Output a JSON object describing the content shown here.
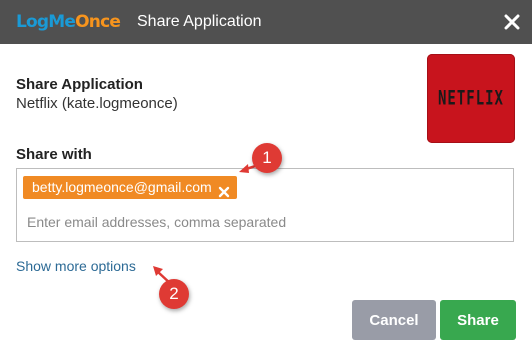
{
  "header": {
    "logo": {
      "part1": "LogMe",
      "part2": "Once"
    },
    "title": "Share Application",
    "close_icon": "close-icon"
  },
  "app": {
    "section_title": "Share Application",
    "subtitle": "Netflix (kate.logmeonce)",
    "logo_text": "NETFLIX"
  },
  "share": {
    "label": "Share with",
    "chips": [
      {
        "email": "betty.logmeonce@gmail.com"
      }
    ],
    "placeholder": "Enter email addresses, comma separated",
    "more_options": "Show more options"
  },
  "annotations": [
    {
      "number": "1"
    },
    {
      "number": "2"
    }
  ],
  "buttons": {
    "cancel": "Cancel",
    "share": "Share"
  },
  "colors": {
    "titlebar": "#505050",
    "chip": "#f08a24",
    "cancel": "#999ca7",
    "share": "#38a84f",
    "link": "#2c6a95",
    "badge": "#df3a34"
  }
}
